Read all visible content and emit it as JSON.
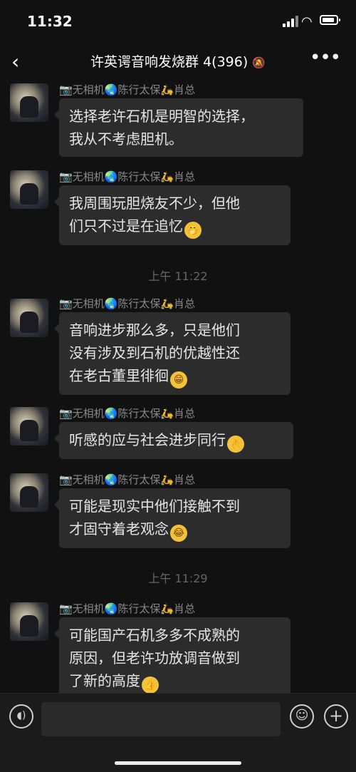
{
  "status_bar": {
    "time": "11:32"
  },
  "header": {
    "back": "‹",
    "title": "许英谔音响发烧群 4(396)",
    "mute_icon": "🔕",
    "more": "•••"
  },
  "messages": [
    {
      "nickname": "📷无相机🌏陈行太保🛵肖总",
      "text": "选择老许石机是明智的选择，\n我从不考虑胆机。",
      "emoji": ""
    },
    {
      "nickname": "📷无相机🌏陈行太保🛵肖总",
      "text": "我周围玩胆烧友不少，但他\n们只不过是在追忆",
      "emoji": "🤭"
    },
    {
      "nickname": "📷无相机🌏陈行太保🛵肖总",
      "text": "音响进步那么多，只是他们\n没有涉及到石机的优越性还\n在老古董里徘徊",
      "emoji": "😁"
    },
    {
      "nickname": "📷无相机🌏陈行太保🛵肖总",
      "text": "听感的应与社会进步同行",
      "emoji": "👌"
    },
    {
      "nickname": "📷无相机🌏陈行太保🛵肖总",
      "text": "可能是现实中他们接触不到\n才固守着老观念",
      "emoji": "😂"
    },
    {
      "nickname": "📷无相机🌏陈行太保🛵肖总",
      "text": "可能国产石机多多不成熟的\n原因，但老许功放调音做到\n了新的高度",
      "emoji": "👍"
    }
  ],
  "timestamps": [
    "上午 11:22",
    "上午 11:29"
  ],
  "input_bar": {
    "voice_icon": "◖)",
    "emoji_icon": "☺",
    "plus_icon": "+"
  }
}
